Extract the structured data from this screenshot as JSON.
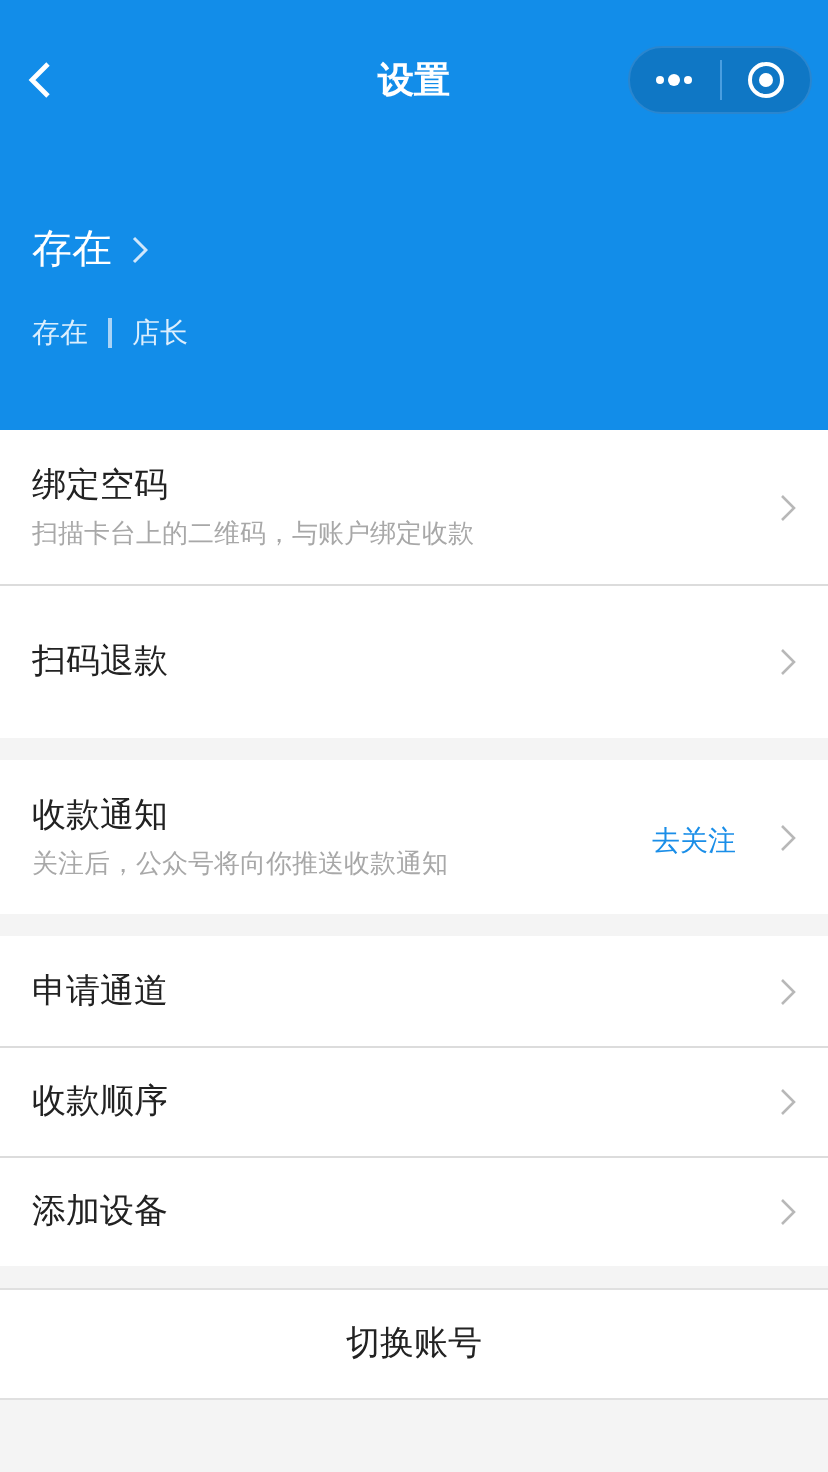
{
  "nav": {
    "title": "设置"
  },
  "profile": {
    "name": "存在",
    "store": "存在",
    "role": "店长"
  },
  "groups": [
    {
      "rows": [
        {
          "title": "绑定空码",
          "subtitle": "扫描卡台上的二维码，与账户绑定收款"
        },
        {
          "title": "扫码退款"
        }
      ]
    },
    {
      "rows": [
        {
          "title": "收款通知",
          "subtitle": "关注后，公众号将向你推送收款通知",
          "action": "去关注"
        }
      ]
    },
    {
      "rows": [
        {
          "title": "申请通道"
        },
        {
          "title": "收款顺序"
        },
        {
          "title": "添加设备"
        }
      ]
    }
  ],
  "footer_button": "切换账号"
}
